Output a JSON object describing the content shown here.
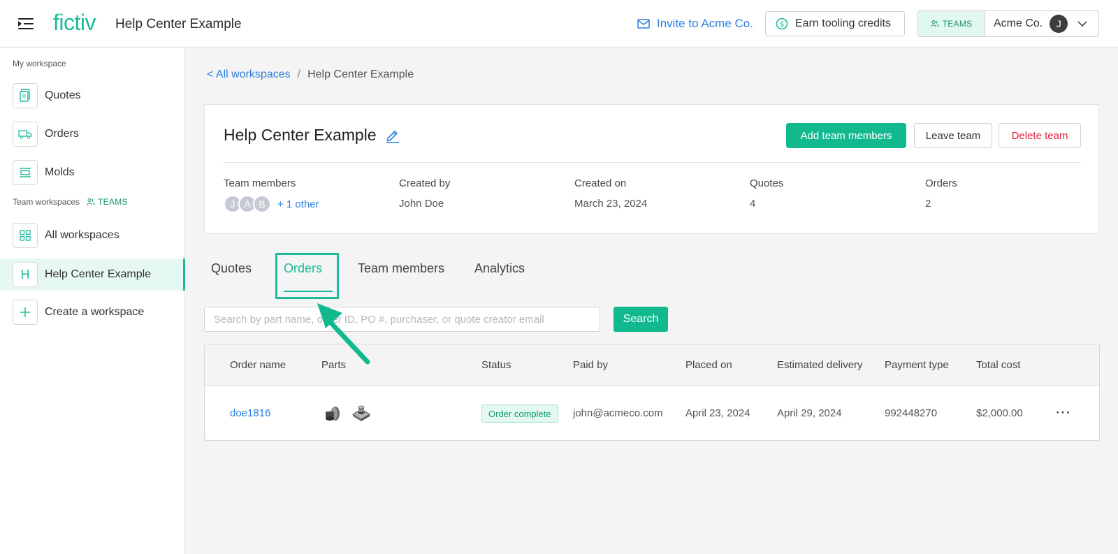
{
  "header": {
    "logo": "fictiv",
    "title": "Help Center Example",
    "invite_label": "Invite to Acme Co.",
    "earn_label": "Earn tooling credits",
    "teams_chip": "TEAMS",
    "account_name": "Acme Co.",
    "account_initial": "J",
    "accent_color": "#1db99a"
  },
  "sidebar": {
    "my_workspace_label": "My workspace",
    "my_items": [
      {
        "label": "Quotes",
        "icon": "quotes-icon"
      },
      {
        "label": "Orders",
        "icon": "truck-icon"
      },
      {
        "label": "Molds",
        "icon": "mold-icon"
      }
    ],
    "team_workspaces_label": "Team workspaces",
    "teams_tag": "TEAMS",
    "team_items": [
      {
        "label": "All workspaces",
        "icon": "grid-icon"
      },
      {
        "label": "Help Center Example",
        "icon": "letter-h-icon",
        "icon_text": "H",
        "active": true
      },
      {
        "label": "Create a workspace",
        "icon": "plus-icon",
        "icon_text": "+"
      }
    ]
  },
  "breadcrumb": {
    "back_label": "< All workspaces",
    "separator": "/",
    "current": "Help Center Example"
  },
  "team_card": {
    "title": "Help Center Example",
    "add_label": "Add team members",
    "leave_label": "Leave team",
    "delete_label": "Delete team",
    "stats": {
      "members_label": "Team members",
      "member_initials": [
        "J",
        "A",
        "B"
      ],
      "other_label": "+ 1 other",
      "created_by_label": "Created by",
      "created_by": "John Doe",
      "created_on_label": "Created on",
      "created_on": "March 23, 2024",
      "quotes_label": "Quotes",
      "quotes": "4",
      "orders_label": "Orders",
      "orders": "2"
    }
  },
  "tabs": [
    {
      "label": "Quotes",
      "active": false
    },
    {
      "label": "Orders",
      "active": true
    },
    {
      "label": "Team members",
      "active": false
    },
    {
      "label": "Analytics",
      "active": false
    }
  ],
  "search": {
    "placeholder": "Search by part name, order ID, PO #, purchaser, or quote creator email",
    "button_label": "Search"
  },
  "orders_table": {
    "columns": [
      "Order name",
      "Parts",
      "Status",
      "Paid by",
      "Placed on",
      "Estimated delivery",
      "Payment type",
      "Total cost"
    ],
    "rows": [
      {
        "order_name": "doe1816",
        "status": "Order complete",
        "paid_by": "john@acmeco.com",
        "placed_on": "April 23, 2024",
        "estimated_delivery": "April 29, 2024",
        "payment_type": "992448270",
        "total_cost": "$2,000.00",
        "more": "⋯"
      }
    ]
  }
}
